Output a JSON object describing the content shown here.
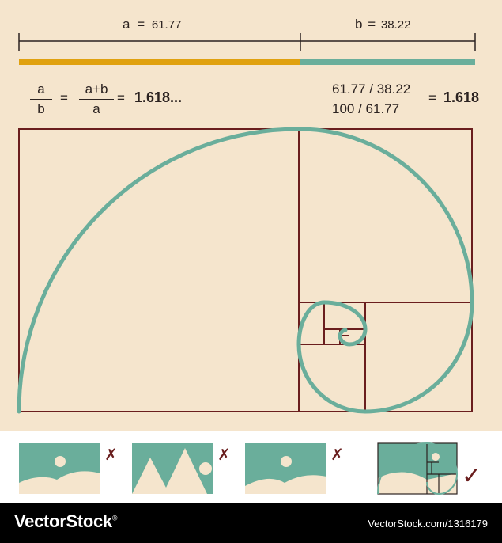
{
  "segment": {
    "a_label": "a",
    "a_eq": "=",
    "a_value": "61.77",
    "b_label": "b",
    "b_eq": "=",
    "b_value": "38.22",
    "a_color": "#e0a10f",
    "b_color": "#6aae9b"
  },
  "formula": {
    "frac1_num": "a",
    "frac1_den": "b",
    "eq1": "=",
    "frac2_num": "a+b",
    "frac2_den": "a",
    "eq2": "=",
    "result1": "1.618...",
    "line1": "61.77 / 38.22",
    "line2": "100 / 61.77",
    "eq3": "=",
    "result2": "1.618"
  },
  "colors": {
    "background": "#f5e5cd",
    "frame": "#6a1e1e",
    "spiral": "#6aae9b"
  },
  "examples": {
    "marks": [
      "✗",
      "✗",
      "✗",
      "✓"
    ]
  },
  "footer": {
    "brand": "VectorStock",
    "brand_mark": "®",
    "credit": "VectorStock.com/1316179"
  }
}
